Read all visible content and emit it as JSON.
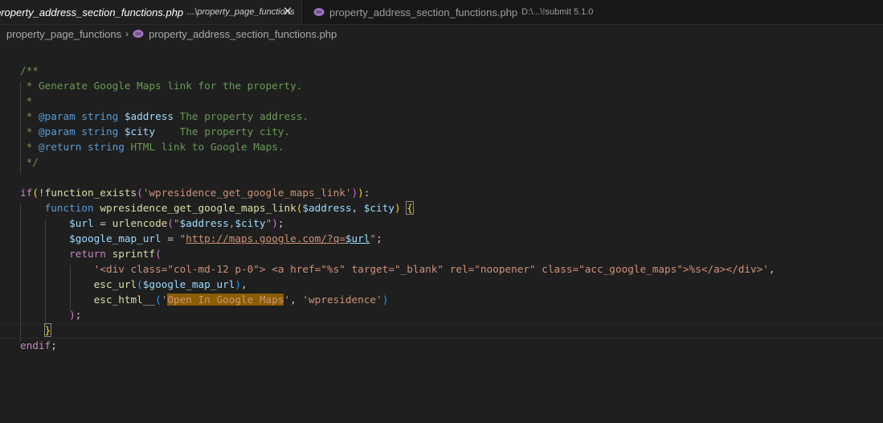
{
  "tabs": [
    {
      "label": "property_address_section_functions.php",
      "description": "...\\property_page_functions",
      "active": true
    },
    {
      "label": "property_address_section_functions.php",
      "description": "D:\\...\\!submit 5.1.0",
      "active": false
    }
  ],
  "close_glyph": "✕",
  "breadcrumb": {
    "folder": "property_page_functions",
    "separator": "›",
    "file": "property_address_section_functions.php"
  },
  "code": {
    "doc": [
      "/**",
      " * Generate Google Maps link for the property.",
      " *",
      " * ",
      " * ",
      " * "
    ],
    "doc_tags": [
      {
        "tag": "@param",
        "type": "string",
        "name": "$address",
        "desc": " The property address."
      },
      {
        "tag": "@param",
        "type": "string",
        "name": "$city",
        "desc": "    The property city."
      },
      {
        "tag": "@return",
        "type": "string",
        "name": "",
        "desc": " HTML link to Google Maps."
      }
    ],
    "doc_end": " */",
    "if_kw": "if",
    "fe_open": "(!",
    "fe_fn": "function_exists",
    "fe_arg": "'wpresidence_get_google_maps_link'",
    "fe_close": "):",
    "function_kw": "function",
    "func_name": "wpresidence_get_google_maps_link",
    "param1": "$address",
    "param2": "$city",
    "url_var": "$url",
    "urlencode_fn": "urlencode",
    "urlencode_arg_q": "\"",
    "urlencode_arg_v1": "$address",
    "urlencode_arg_comma": ",",
    "urlencode_arg_v2": "$city",
    "gmap_var": "$google_map_url",
    "gmap_url": "http://maps.google.com/?q=",
    "return_kw": "return",
    "sprintf_fn": "sprintf",
    "fmt_string": "'<div class=\"col-md-12 p-0\"> <a href=\"%s\" target=\"_blank\" rel=\"noopener\" class=\"acc_google_maps\">%s</a></div>'",
    "esc_url_fn": "esc_url",
    "esc_html_fn": "esc_html__",
    "link_text": "Open In Google Maps",
    "text_domain": "'wpresidence'",
    "endif_kw": "endif"
  },
  "colors": {
    "background": "#1f1f1f",
    "comment": "#6a9955",
    "keyword": "#569cd6",
    "control": "#c586c0",
    "function": "#dcdcaa",
    "variable": "#9cdcfe",
    "string": "#ce9178",
    "find_highlight": "#8a5d00",
    "php_icon": "#a074c4"
  }
}
